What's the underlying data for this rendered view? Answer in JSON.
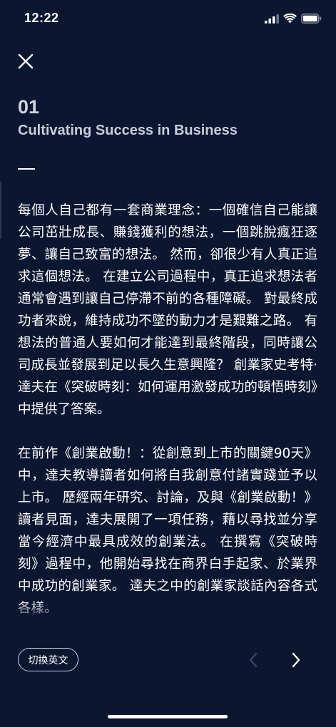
{
  "status_bar": {
    "time": "12:22"
  },
  "chapter": {
    "number": "01",
    "title": "Cultivating Success in Business"
  },
  "paragraphs": [
    "每個人自己都有一套商業理念：一個確信自己能讓公司茁壯成長、賺錢獲利的想法，一個跳脫瘋狂逐夢、讓自己致富的想法。 然而，卻很少有人真正追求這個想法。 在建立公司過程中，真正追求想法者通常會遇到讓自己停滯不前的各種障礙。 對最終成功者來說，維持成功不墜的動力才是艱難之路。 有想法的普通人要如何才能達到最終階段，同時讓公司成長並發展到足以長久生意興隆？ 創業家史考特·達夫在《突破時刻：如何運用激發成功的頓悟時刻》中提供了答案。",
    "在前作《創業啟動！：從創意到上市的關鍵90天》中，達夫教導讀者如何將自我創意付諸實踐並予以上市。 歷經兩年研究、討論，及與《創業啟動！》讀者見面，達夫展開了一項任務，藉以尋找並分享當今經濟中最具成效的創業法。 在撰寫《突破時刻》過程中，他開始尋找在商界白手起家、於業界中成功的創業家。 達夫之中的創業家談話內容各式各樣。"
  ],
  "toolbar": {
    "lang_toggle_label": "切換英文"
  },
  "colors": {
    "background": "#0b1631",
    "text": "#ffffff",
    "muted_heading": "#c9cdd6",
    "disabled_icon": "#3a4666"
  }
}
